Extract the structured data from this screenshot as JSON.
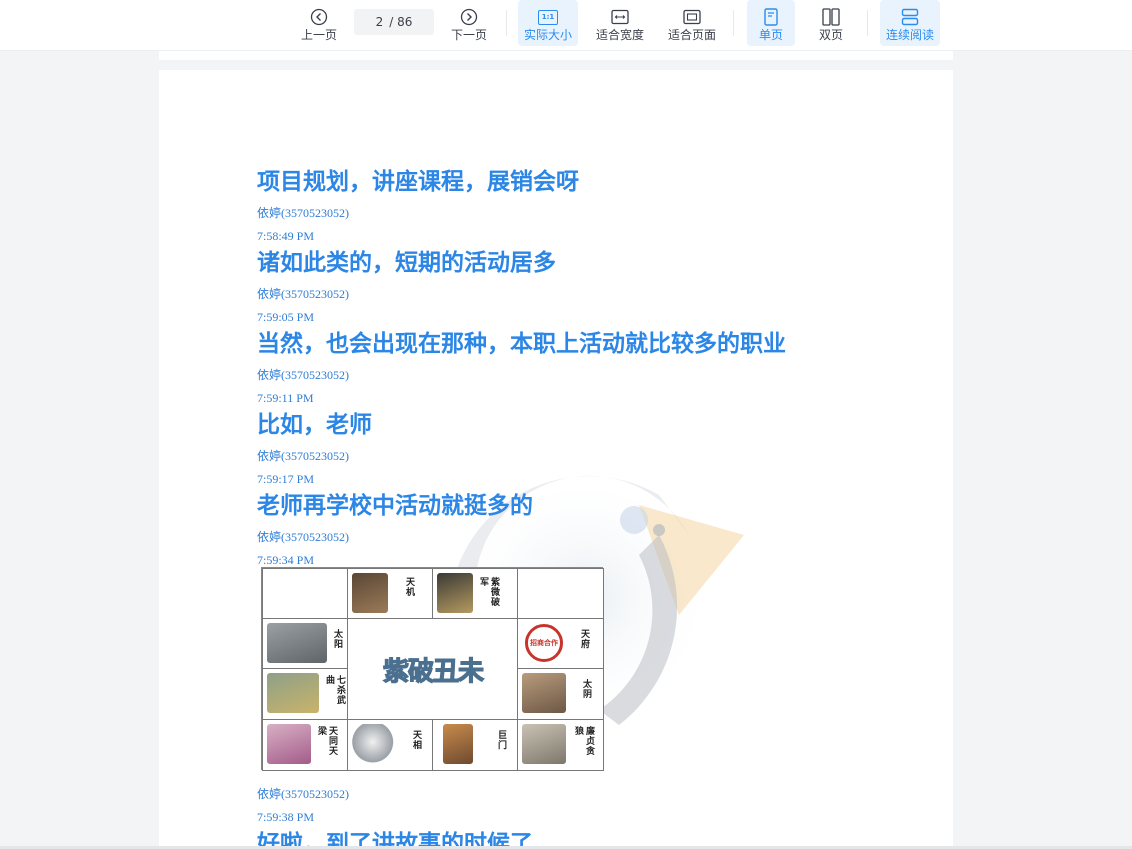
{
  "toolbar": {
    "prev_label": "上一页",
    "next_label": "下一页",
    "current_page": "2",
    "total_pages": "/ 86",
    "actual_size_label": "实际大小",
    "actual_size_icon_text": "1:1",
    "fit_width_label": "适合宽度",
    "fit_page_label": "适合页面",
    "single_page_label": "单页",
    "double_page_label": "双页",
    "continuous_label": "连续阅读",
    "accent_color": "#2a8cf0"
  },
  "entries": [
    {
      "text": "项目规划，讲座课程，展销会呀",
      "sender": "依婷(3570523052)",
      "time": "7:58:49 PM"
    },
    {
      "text": "诸如此类的，短期的活动居多",
      "sender": "依婷(3570523052)",
      "time": "7:59:05 PM"
    },
    {
      "text": "当然，也会出现在那种，本职上活动就比较多的职业",
      "sender": "依婷(3570523052)",
      "time": "7:59:11 PM"
    },
    {
      "text": "比如，老师",
      "sender": "依婷(3570523052)",
      "time": "7:59:17 PM"
    },
    {
      "text": "老师再学校中活动就挺多的",
      "sender": "依婷(3570523052)",
      "time": "7:59:34 PM"
    }
  ],
  "chart": {
    "center_title": "紫破丑未",
    "palaces": [
      {
        "name": "天机"
      },
      {
        "name": "紫微破军"
      },
      {
        "name": "天府"
      },
      {
        "name": "太阴"
      },
      {
        "name": "廉贞贪狼"
      },
      {
        "name": "巨门"
      },
      {
        "name": "天相"
      },
      {
        "name": "天同天梁"
      },
      {
        "name": "七杀武曲"
      },
      {
        "name": "太阳"
      }
    ],
    "badge_text": "招商合作"
  },
  "after_chart": {
    "sender": "依婷(3570523052)",
    "time": "7:59:38 PM",
    "text": "好啦，到了讲故事的时候了"
  },
  "colors": {
    "message": "#2b86e6",
    "meta": "#2e7dd6"
  }
}
